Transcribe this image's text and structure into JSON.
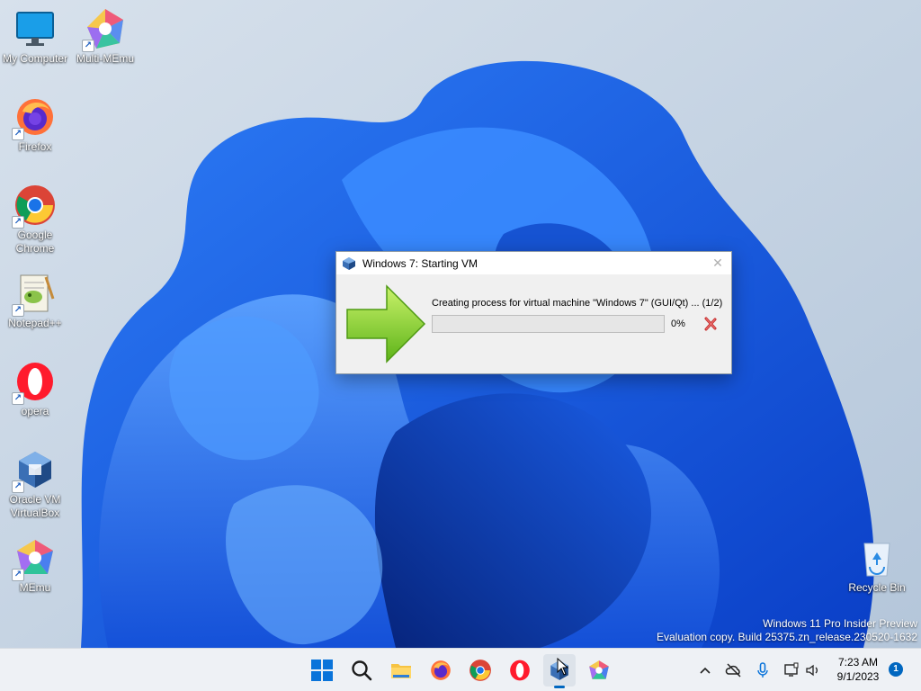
{
  "desktop": {
    "icons": [
      {
        "label": "My Computer",
        "icon": "monitor-icon"
      },
      {
        "label": "Multi-MEmu",
        "icon": "multi-memu-icon"
      },
      {
        "label": "Firefox",
        "icon": "firefox-icon"
      },
      {
        "label": "Google Chrome",
        "icon": "chrome-icon"
      },
      {
        "label": "Notepad++",
        "icon": "notepadpp-icon"
      },
      {
        "label": "opera",
        "icon": "opera-icon"
      },
      {
        "label": "Oracle VM VirtualBox",
        "icon": "virtualbox-icon"
      },
      {
        "label": "MEmu",
        "icon": "memu-icon"
      },
      {
        "label": "Recycle Bin",
        "icon": "recycle-bin-icon"
      }
    ],
    "watermark": {
      "line1": "Windows 11 Pro Insider Preview",
      "line2": "Evaluation copy. Build 25375.zn_release.230520-1632"
    }
  },
  "dialog": {
    "title": "Windows 7: Starting VM",
    "status": "Creating process for virtual machine \"Windows 7\" (GUI/Qt) ... (1/2)",
    "progress": 0,
    "percent_text": "0%",
    "close_glyph": "✕",
    "icons": {
      "app": "virtualbox-icon",
      "arrow": "green-arrow-icon",
      "cancel": "cancel-x-icon"
    }
  },
  "taskbar": {
    "apps": [
      "start",
      "search",
      "file-explorer",
      "firefox",
      "chrome",
      "opera",
      "virtualbox",
      "memu"
    ],
    "active_app": "virtualbox",
    "clock_time": "7:23 AM",
    "clock_date": "9/1/2023",
    "notification_count": "1"
  },
  "colors": {
    "accent": "#0067c0",
    "taskbar_bg": "#eef1f5",
    "arrow_green": "#8ed62a"
  }
}
